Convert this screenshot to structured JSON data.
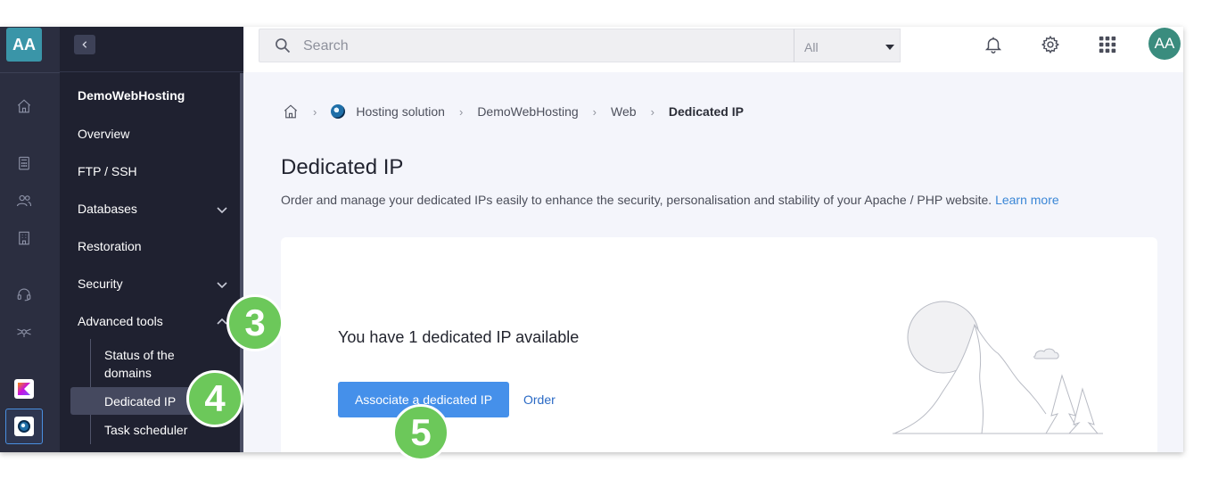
{
  "rail": {
    "avatar_initials": "AA",
    "icons": [
      "home-icon",
      "calculator-icon",
      "users-icon",
      "building-icon",
      "headset-icon",
      "network-icon"
    ]
  },
  "nav": {
    "title": "DemoWebHosting",
    "items": [
      {
        "label": "Overview"
      },
      {
        "label": "FTP / SSH"
      },
      {
        "label": "Databases",
        "chevron": "down"
      },
      {
        "label": "Restoration"
      },
      {
        "label": "Security",
        "chevron": "down"
      },
      {
        "label": "Advanced tools",
        "chevron": "up"
      }
    ],
    "sub_items": [
      {
        "label": "Status of the domains"
      },
      {
        "label": "Dedicated IP",
        "active": true
      },
      {
        "label": "Task scheduler"
      }
    ]
  },
  "topbar": {
    "search_placeholder": "Search",
    "scope_value": "All",
    "avatar_initials": "AA"
  },
  "breadcrumb": {
    "items": [
      "Hosting solution",
      "DemoWebHosting",
      "Web"
    ],
    "current": "Dedicated IP"
  },
  "page": {
    "title": "Dedicated IP",
    "description": "Order and manage your dedicated IPs easily to enhance the security, personalisation and stability of your Apache / PHP website.",
    "learn_more": "Learn more"
  },
  "card": {
    "title": "You have 1 dedicated IP available",
    "primary_button": "Associate a dedicated IP",
    "secondary_link": "Order"
  },
  "annotations": [
    "3",
    "4",
    "5"
  ],
  "colors": {
    "accent": "#4590ea",
    "step_badge": "#6cc85a",
    "sidebar": "#1f2130",
    "rail": "#2b2e40"
  }
}
